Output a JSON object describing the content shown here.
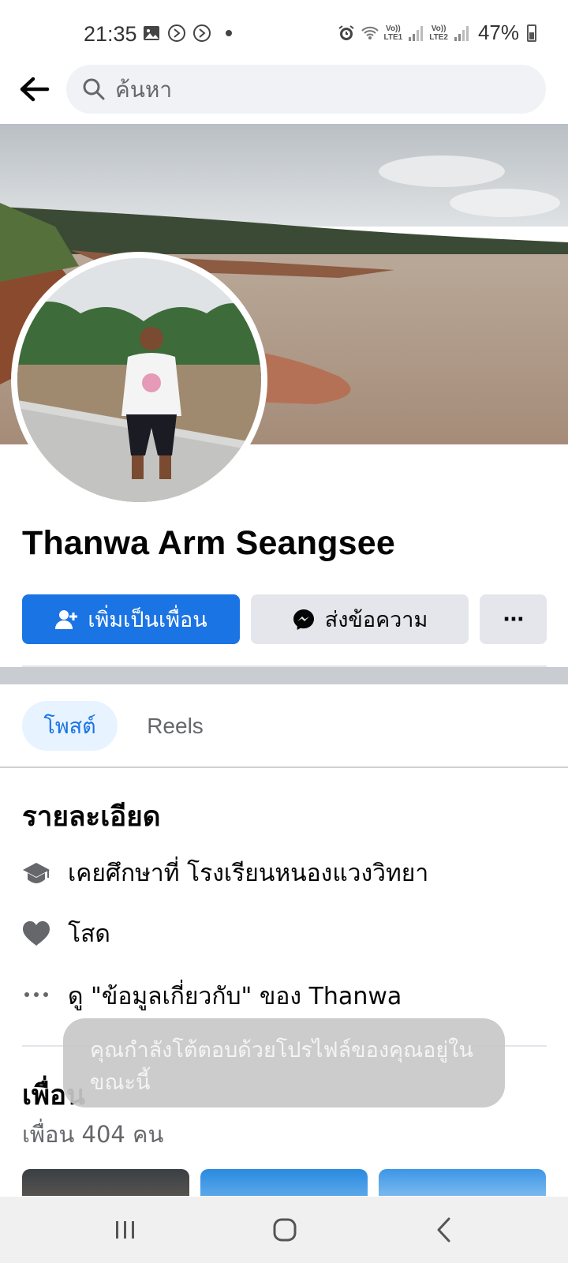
{
  "status_bar": {
    "time": "21:35",
    "net1": "Vo))\nLTE1",
    "net2": "Vo))\nLTE2",
    "battery": "47%"
  },
  "search": {
    "placeholder": "ค้นหา"
  },
  "profile": {
    "name": "Thanwa Arm Seangsee"
  },
  "actions": {
    "add_friend": "เพิ่มเป็นเพื่อน",
    "message": "ส่งข้อความ",
    "more": "···"
  },
  "tabs": {
    "posts": "โพสต์",
    "reels": "Reels"
  },
  "details": {
    "title": "รายละเอียด",
    "education": "เคยศึกษาที่ โรงเรียนหนองแวงวิทยา",
    "relationship": "โสด",
    "see_about": "ดู \"ข้อมูลเกี่ยวกับ\" ของ Thanwa"
  },
  "friends": {
    "title": "เพื่อน",
    "count": "เพื่อน 404 คน"
  },
  "toast": {
    "message": "คุณกำลังโต้ตอบด้วยโปรไฟล์ของคุณอยู่ในขณะนี้"
  },
  "colors": {
    "primary": "#1b74e4",
    "secondary_button": "#e4e6eb",
    "tab_active_bg": "#e7f3ff"
  }
}
